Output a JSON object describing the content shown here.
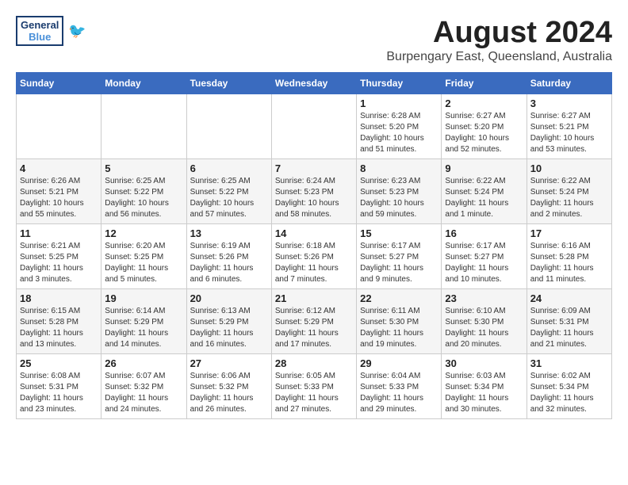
{
  "header": {
    "logo_general": "General",
    "logo_blue": "Blue",
    "month_title": "August 2024",
    "location": "Burpengary East, Queensland, Australia"
  },
  "days_of_week": [
    "Sunday",
    "Monday",
    "Tuesday",
    "Wednesday",
    "Thursday",
    "Friday",
    "Saturday"
  ],
  "weeks": [
    [
      {
        "day": "",
        "info": ""
      },
      {
        "day": "",
        "info": ""
      },
      {
        "day": "",
        "info": ""
      },
      {
        "day": "",
        "info": ""
      },
      {
        "day": "1",
        "info": "Sunrise: 6:28 AM\nSunset: 5:20 PM\nDaylight: 10 hours\nand 51 minutes."
      },
      {
        "day": "2",
        "info": "Sunrise: 6:27 AM\nSunset: 5:20 PM\nDaylight: 10 hours\nand 52 minutes."
      },
      {
        "day": "3",
        "info": "Sunrise: 6:27 AM\nSunset: 5:21 PM\nDaylight: 10 hours\nand 53 minutes."
      }
    ],
    [
      {
        "day": "4",
        "info": "Sunrise: 6:26 AM\nSunset: 5:21 PM\nDaylight: 10 hours\nand 55 minutes."
      },
      {
        "day": "5",
        "info": "Sunrise: 6:25 AM\nSunset: 5:22 PM\nDaylight: 10 hours\nand 56 minutes."
      },
      {
        "day": "6",
        "info": "Sunrise: 6:25 AM\nSunset: 5:22 PM\nDaylight: 10 hours\nand 57 minutes."
      },
      {
        "day": "7",
        "info": "Sunrise: 6:24 AM\nSunset: 5:23 PM\nDaylight: 10 hours\nand 58 minutes."
      },
      {
        "day": "8",
        "info": "Sunrise: 6:23 AM\nSunset: 5:23 PM\nDaylight: 10 hours\nand 59 minutes."
      },
      {
        "day": "9",
        "info": "Sunrise: 6:22 AM\nSunset: 5:24 PM\nDaylight: 11 hours\nand 1 minute."
      },
      {
        "day": "10",
        "info": "Sunrise: 6:22 AM\nSunset: 5:24 PM\nDaylight: 11 hours\nand 2 minutes."
      }
    ],
    [
      {
        "day": "11",
        "info": "Sunrise: 6:21 AM\nSunset: 5:25 PM\nDaylight: 11 hours\nand 3 minutes."
      },
      {
        "day": "12",
        "info": "Sunrise: 6:20 AM\nSunset: 5:25 PM\nDaylight: 11 hours\nand 5 minutes."
      },
      {
        "day": "13",
        "info": "Sunrise: 6:19 AM\nSunset: 5:26 PM\nDaylight: 11 hours\nand 6 minutes."
      },
      {
        "day": "14",
        "info": "Sunrise: 6:18 AM\nSunset: 5:26 PM\nDaylight: 11 hours\nand 7 minutes."
      },
      {
        "day": "15",
        "info": "Sunrise: 6:17 AM\nSunset: 5:27 PM\nDaylight: 11 hours\nand 9 minutes."
      },
      {
        "day": "16",
        "info": "Sunrise: 6:17 AM\nSunset: 5:27 PM\nDaylight: 11 hours\nand 10 minutes."
      },
      {
        "day": "17",
        "info": "Sunrise: 6:16 AM\nSunset: 5:28 PM\nDaylight: 11 hours\nand 11 minutes."
      }
    ],
    [
      {
        "day": "18",
        "info": "Sunrise: 6:15 AM\nSunset: 5:28 PM\nDaylight: 11 hours\nand 13 minutes."
      },
      {
        "day": "19",
        "info": "Sunrise: 6:14 AM\nSunset: 5:29 PM\nDaylight: 11 hours\nand 14 minutes."
      },
      {
        "day": "20",
        "info": "Sunrise: 6:13 AM\nSunset: 5:29 PM\nDaylight: 11 hours\nand 16 minutes."
      },
      {
        "day": "21",
        "info": "Sunrise: 6:12 AM\nSunset: 5:29 PM\nDaylight: 11 hours\nand 17 minutes."
      },
      {
        "day": "22",
        "info": "Sunrise: 6:11 AM\nSunset: 5:30 PM\nDaylight: 11 hours\nand 19 minutes."
      },
      {
        "day": "23",
        "info": "Sunrise: 6:10 AM\nSunset: 5:30 PM\nDaylight: 11 hours\nand 20 minutes."
      },
      {
        "day": "24",
        "info": "Sunrise: 6:09 AM\nSunset: 5:31 PM\nDaylight: 11 hours\nand 21 minutes."
      }
    ],
    [
      {
        "day": "25",
        "info": "Sunrise: 6:08 AM\nSunset: 5:31 PM\nDaylight: 11 hours\nand 23 minutes."
      },
      {
        "day": "26",
        "info": "Sunrise: 6:07 AM\nSunset: 5:32 PM\nDaylight: 11 hours\nand 24 minutes."
      },
      {
        "day": "27",
        "info": "Sunrise: 6:06 AM\nSunset: 5:32 PM\nDaylight: 11 hours\nand 26 minutes."
      },
      {
        "day": "28",
        "info": "Sunrise: 6:05 AM\nSunset: 5:33 PM\nDaylight: 11 hours\nand 27 minutes."
      },
      {
        "day": "29",
        "info": "Sunrise: 6:04 AM\nSunset: 5:33 PM\nDaylight: 11 hours\nand 29 minutes."
      },
      {
        "day": "30",
        "info": "Sunrise: 6:03 AM\nSunset: 5:34 PM\nDaylight: 11 hours\nand 30 minutes."
      },
      {
        "day": "31",
        "info": "Sunrise: 6:02 AM\nSunset: 5:34 PM\nDaylight: 11 hours\nand 32 minutes."
      }
    ]
  ]
}
